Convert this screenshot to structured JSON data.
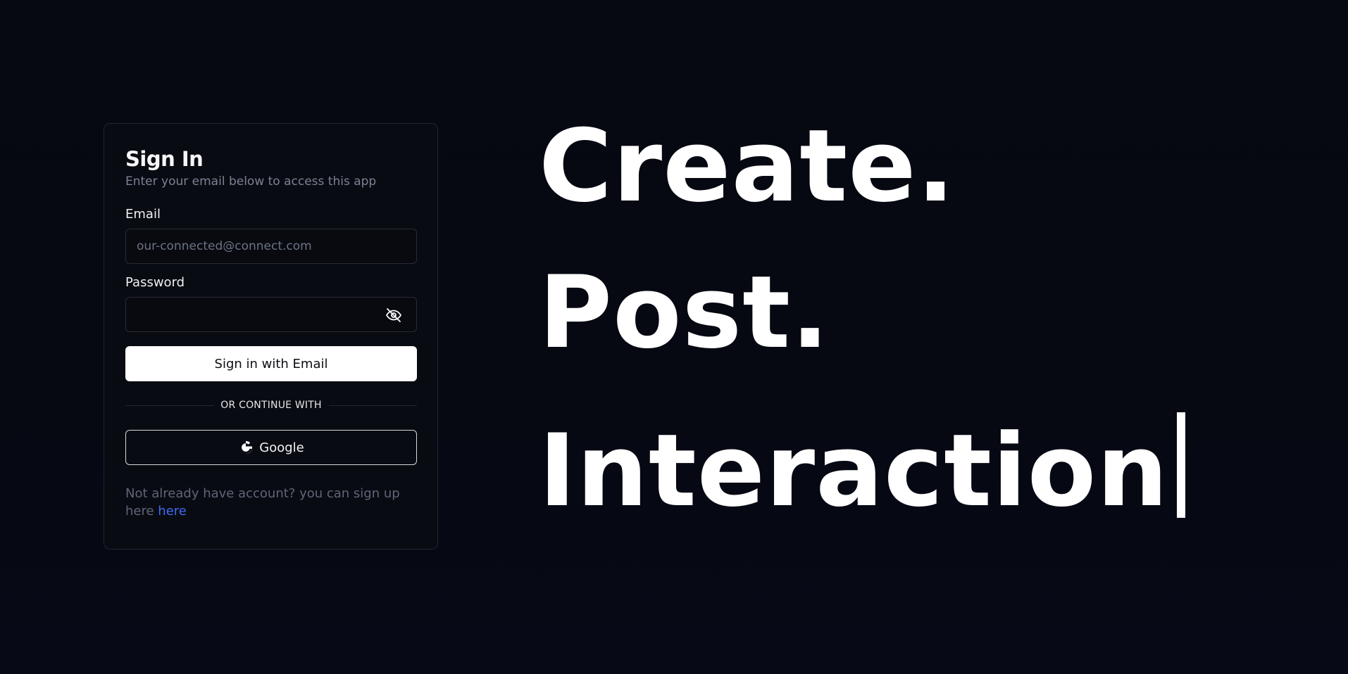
{
  "signin": {
    "title": "Sign In",
    "subtitle": "Enter your email below to access this app",
    "email_label": "Email",
    "email_placeholder": "our-connected@connect.com",
    "email_value": "",
    "password_label": "Password",
    "password_value": "",
    "submit_label": "Sign in with Email",
    "divider_text": "OR CONTINUE WITH",
    "google_label": "Google",
    "signup_text": "Not already have account? you can sign up here ",
    "signup_link": "here"
  },
  "hero": {
    "line1": "Create.",
    "line2": "Post.",
    "line3": "Interaction"
  },
  "icons": {
    "password_toggle": "eye-off-icon",
    "google": "google-icon"
  },
  "colors": {
    "background": "#060811",
    "link": "#3e6bf0",
    "primary_button": "#ffffff"
  }
}
